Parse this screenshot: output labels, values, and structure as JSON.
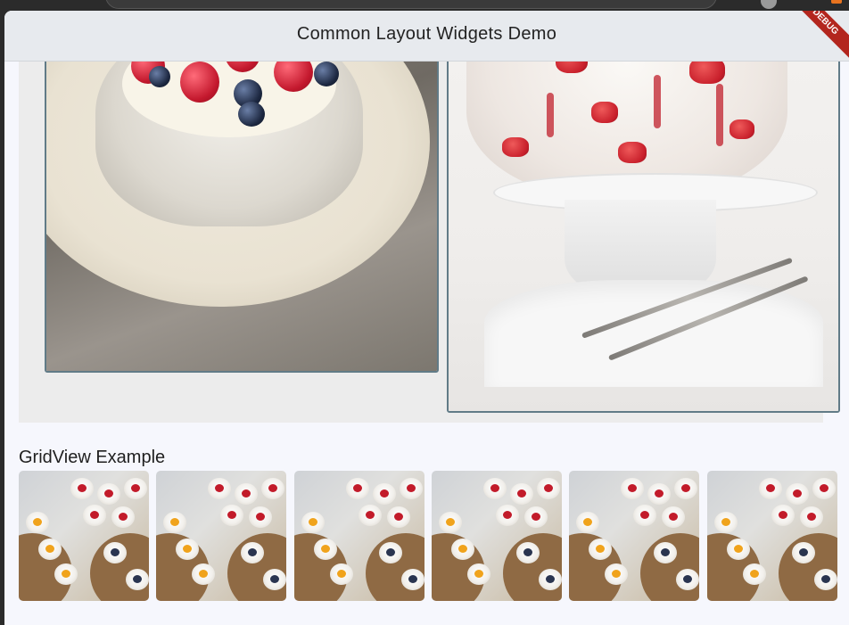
{
  "app": {
    "title": "Common Layout Widgets Demo",
    "debug_banner": "DEBUG"
  },
  "stack_section": {
    "images": [
      {
        "name": "pavlova with raspberries and blueberries"
      },
      {
        "name": "strawberry pavlova tower on cake stand"
      }
    ]
  },
  "grid_section": {
    "title": "GridView Example",
    "tile_count": 6
  },
  "colors": {
    "appbar": "#e7eaee",
    "page_background": "#f6f7fd",
    "stack_background": "#ececec",
    "card_border": "#617b87",
    "debug_ribbon": "#b3261e"
  }
}
